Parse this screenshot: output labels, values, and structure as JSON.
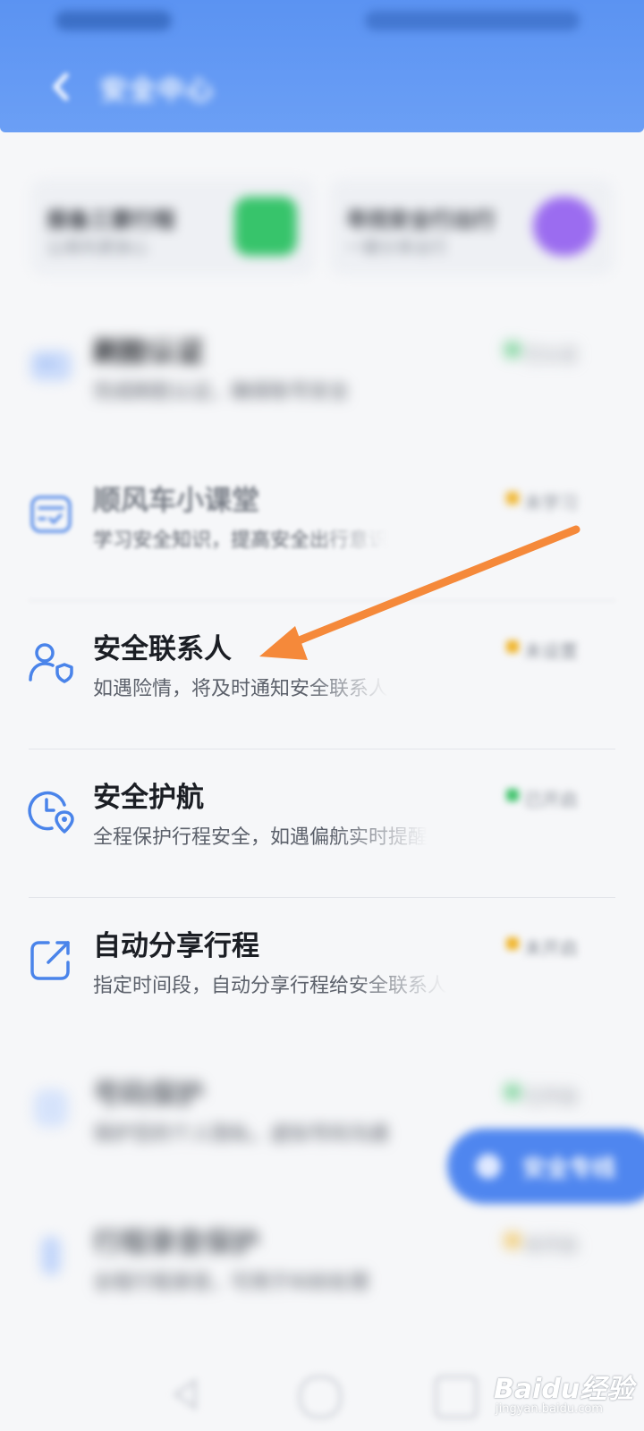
{
  "header": {
    "title": "安全中心",
    "background": "#5b93f2"
  },
  "top_cards": [
    {
      "title": "报备三要行程",
      "subtitle": "让顺风更放心",
      "icon": "car-shield-icon",
      "icon_color": "#37c46b"
    },
    {
      "title": "寻找安全行出行",
      "subtitle": "一键分享出行",
      "icon": "person-shield-icon",
      "icon_color": "#9b6cf0"
    }
  ],
  "list": {
    "items": [
      {
        "title": "刷脸认证",
        "subtitle": "完成刷脸认证，确保账号安全",
        "badge": "已认证",
        "badge_color": "#3ec26a",
        "icon": "id-card-icon"
      },
      {
        "title": "顺风车小课堂",
        "subtitle": "学习安全知识，提高安全出行意识",
        "badge": "未学习",
        "badge_color": "#f0b429",
        "icon": "course-check-icon"
      },
      {
        "title": "安全联系人",
        "subtitle": "如遇险情，将及时通知安全联系人",
        "badge": "未设置",
        "badge_color": "#f0b429",
        "icon": "contact-shield-icon"
      },
      {
        "title": "安全护航",
        "subtitle": "全程保护行程安全，如遇偏航实时提醒",
        "badge": "已开启",
        "badge_color": "#3ec26a",
        "icon": "clock-location-icon"
      },
      {
        "title": "自动分享行程",
        "subtitle": "指定时间段，自动分享行程给安全联系人",
        "badge": "未开启",
        "badge_color": "#f0b429",
        "icon": "share-icon"
      },
      {
        "title": "号码保护",
        "subtitle": "保护您的个人隐私，虚拟号码沟通",
        "badge": "已开启",
        "badge_color": "#3ec26a",
        "icon": "phone-shield-icon"
      },
      {
        "title": "行程录音保护",
        "subtitle": "全程行程录音，可用于纠纷处理",
        "badge": "未开启",
        "badge_color": "#f0b429",
        "icon": "mic-icon"
      }
    ]
  },
  "float_button": {
    "label": "安全专线",
    "icon": "headset-icon"
  },
  "nav": {
    "back": "nav-back-icon",
    "home": "nav-home-icon",
    "recents": "nav-recents-icon"
  },
  "annotation": {
    "arrow_color": "#f5893a",
    "points_to": "安全联系人"
  },
  "watermark": {
    "main": "Baidu经验",
    "sub": "jingyan.baidu.com"
  }
}
